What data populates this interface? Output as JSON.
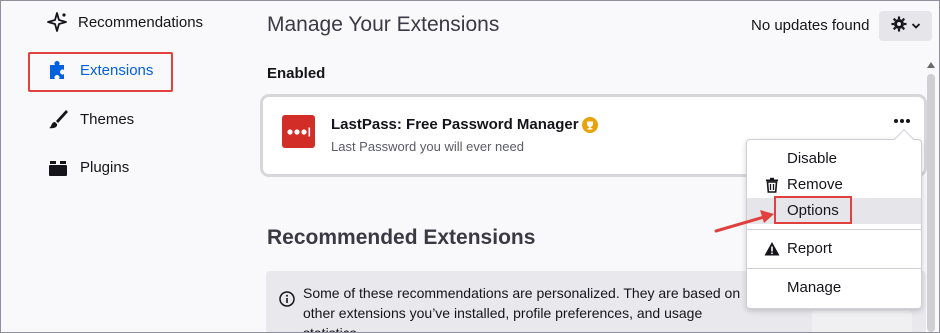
{
  "sidebar": {
    "items": [
      {
        "label": "Recommendations",
        "icon": "sparkle-icon"
      },
      {
        "label": "Extensions",
        "icon": "puzzle-icon",
        "active": true
      },
      {
        "label": "Themes",
        "icon": "brush-icon"
      },
      {
        "label": "Plugins",
        "icon": "plugin-icon"
      }
    ]
  },
  "header": {
    "title": "Manage Your Extensions",
    "update_status": "No updates found",
    "gear_icon": "gear-icon"
  },
  "enabled": {
    "heading": "Enabled",
    "extension": {
      "name": "LastPass: Free Password Manager",
      "description": "Last Password you will ever need",
      "logo_color": "#d32d27",
      "badge": "recommended-trophy-icon"
    }
  },
  "menu": {
    "items": [
      "Disable",
      "Remove",
      "Options",
      "Report",
      "Manage"
    ]
  },
  "recommended": {
    "heading": "Recommended Extensions",
    "note": "Some of these recommendations are personalized. They are based on other extensions you’ve installed, profile preferences, and usage statistics."
  },
  "colors": {
    "accent": "#0061e0",
    "highlight_annotation": "#e0413f"
  }
}
